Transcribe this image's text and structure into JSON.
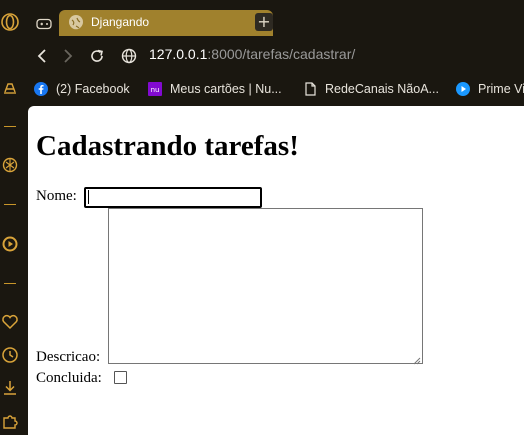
{
  "browser": {
    "tab": {
      "title": "Djangando"
    },
    "address": {
      "host": "127.0.0.1",
      "rest": ":8000/tarefas/cadastrar/"
    },
    "bookmarks": [
      {
        "label": "(2) Facebook",
        "icon": "facebook-icon"
      },
      {
        "label": "Meus cartões | Nu...",
        "icon": "nubank-icon"
      },
      {
        "label": "RedeCanais NãoA...",
        "icon": "document-icon"
      },
      {
        "label": "Prime Vi",
        "icon": "prime-video-icon"
      }
    ],
    "colors": {
      "chrome": "#1a1710",
      "accent": "#c8962a",
      "tab_active": "#a0812d"
    }
  },
  "page": {
    "heading": "Cadastrando tarefas!",
    "form": {
      "nome_label": "Nome:",
      "nome_value": "",
      "descricao_label": "Descricao:",
      "descricao_value": "",
      "concluida_label": "Concluida:",
      "concluida_checked": false
    }
  }
}
